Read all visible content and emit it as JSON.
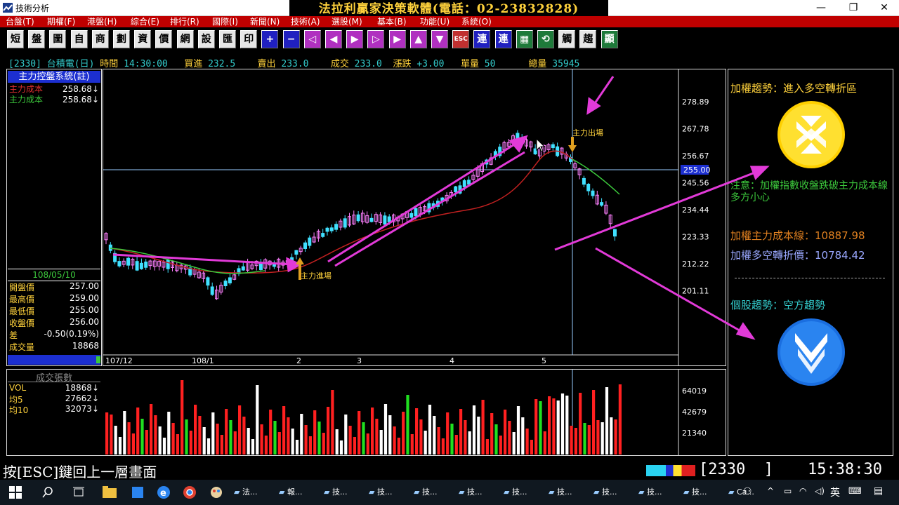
{
  "window": {
    "title": "技術分析",
    "promo": "法拉利贏家決策軟體(電話：02-23832828)",
    "min": "—",
    "max": "❐",
    "close": "✕"
  },
  "menu": [
    "台盤(T)",
    "期權(F)",
    "港盤(H)",
    "綜合(E)",
    "排行(R)",
    "國際(I)",
    "新聞(N)",
    "技術(A)",
    "選股(M)",
    "基本(B)",
    "功能(U)",
    "系統(O)"
  ],
  "toolbar": [
    {
      "t": "短",
      "c": ""
    },
    {
      "t": "盤",
      "c": ""
    },
    {
      "t": "圖",
      "c": ""
    },
    {
      "t": "自",
      "c": ""
    },
    {
      "t": "商",
      "c": ""
    },
    {
      "t": "劃",
      "c": ""
    },
    {
      "t": "資",
      "c": ""
    },
    {
      "t": "價",
      "c": ""
    },
    {
      "t": "網",
      "c": ""
    },
    {
      "t": "設",
      "c": ""
    },
    {
      "t": "匯",
      "c": ""
    },
    {
      "t": "印",
      "c": ""
    },
    {
      "t": "+",
      "c": "blue"
    },
    {
      "t": "−",
      "c": "blue"
    },
    {
      "t": "◁",
      "c": "mag"
    },
    {
      "t": "◀",
      "c": "mag"
    },
    {
      "t": "▶",
      "c": "mag"
    },
    {
      "t": "▷",
      "c": "mag"
    },
    {
      "t": "▶",
      "c": "mag"
    },
    {
      "t": "▲",
      "c": "mag"
    },
    {
      "t": "▼",
      "c": "mag"
    },
    {
      "t": "ESC",
      "c": "red"
    },
    {
      "t": "連",
      "c": "blue"
    },
    {
      "t": "連",
      "c": "blue"
    },
    {
      "t": "▦",
      "c": "green"
    },
    {
      "t": "⟲",
      "c": "green"
    },
    {
      "t": "觸",
      "c": ""
    },
    {
      "t": "趨",
      "c": ""
    },
    {
      "t": "顯",
      "c": "green"
    }
  ],
  "quote": {
    "code": "[2330]",
    "name": "台積電(日)",
    "time_label": "時間",
    "time": "14:30:00",
    "bid_label": "買進",
    "bid": "232.5",
    "ask_label": "賣出",
    "ask": "233.0",
    "deal_label": "成交",
    "deal": "233.0",
    "chg_label": "漲跌",
    "chg": "+3.00",
    "unit_label": "單量",
    "unit": "50",
    "total_label": "總量",
    "total": "35945"
  },
  "side": {
    "title": "主力控盤系統(註)",
    "rows": [
      {
        "k": "主力成本",
        "v": "258.68↓",
        "color": "#e03030"
      },
      {
        "k": "主力成本",
        "v": "258.68↓",
        "color": "#3cc83c"
      }
    ],
    "date": "108/05/10",
    "ohlc": [
      {
        "k": "開盤價",
        "v": "257.00"
      },
      {
        "k": "最高價",
        "v": "259.00"
      },
      {
        "k": "最低價",
        "v": "255.00"
      },
      {
        "k": "收盤價",
        "v": "256.00"
      },
      {
        "k": "差",
        "v": "-0.50(0.19%)"
      },
      {
        "k": "成交量",
        "v": "18868"
      }
    ]
  },
  "vol_side": {
    "title": "成交張數",
    "rows": [
      {
        "k": "VOL",
        "v": "18868↓"
      },
      {
        "k": "均5",
        "v": "27662↓"
      },
      {
        "k": "均10",
        "v": "32073↓"
      }
    ]
  },
  "chart_data": {
    "type": "candlestick",
    "yticks": [
      "278.89",
      "267.78",
      "256.67",
      "245.56",
      "234.44",
      "223.33",
      "212.22",
      "201.11"
    ],
    "current_price": "255.00",
    "xticks": [
      "107/12",
      "108/1",
      "2",
      "3",
      "4",
      "5"
    ],
    "annotations": {
      "enter": "主力進場",
      "exit": "主力出場"
    },
    "vol_ticks": [
      "64019",
      "42679",
      "21340"
    ]
  },
  "right": {
    "trend_label": "加權趨勢：進入多空轉折區",
    "notice": "注意：加權指數收盤跌破主力成本線多方小心",
    "cost_line": "加權主力成本線：10887.98",
    "turn_price": "加權多空轉折價：10784.42",
    "stock_trend": "個股趨勢：空方趨勢"
  },
  "status": {
    "esc": "按[ESC]鍵回上一層畫面",
    "code": "2330",
    "time": "15:38:30"
  },
  "taskbar": [
    "法...",
    "報...",
    "技...",
    "技...",
    "技...",
    "技...",
    "技...",
    "技...",
    "技...",
    "技...",
    "技...",
    "Ca..."
  ],
  "tray": {
    "ime": "英"
  }
}
